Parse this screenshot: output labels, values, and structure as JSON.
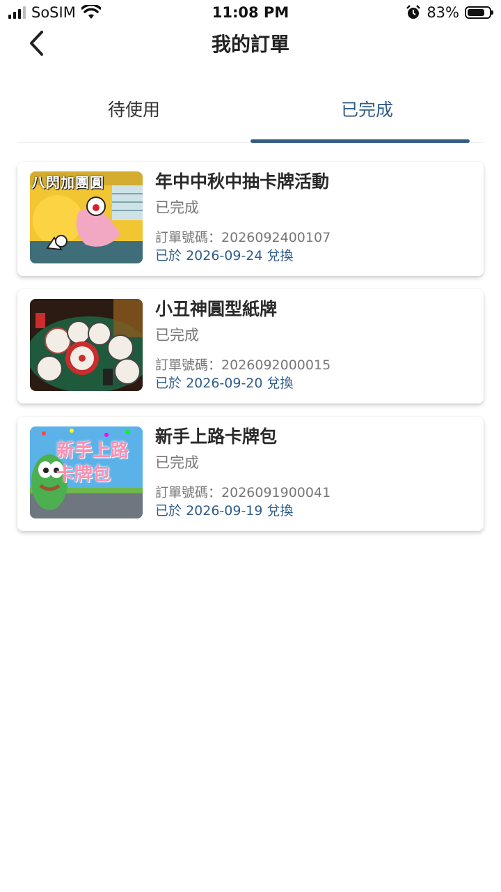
{
  "status_bar": {
    "carrier": "SoSIM",
    "time": "11:08 PM",
    "battery": "83%",
    "battery_level": 0.83,
    "icons": [
      "signal-icon",
      "wifi-icon",
      "alarm-icon",
      "battery-icon"
    ]
  },
  "header": {
    "title": "我的訂單",
    "back_icon": "chevron-left-icon"
  },
  "tabs": [
    {
      "label": "待使用",
      "active": false
    },
    {
      "label": "已完成",
      "active": true
    }
  ],
  "orders": [
    {
      "name": "年中中秋中抽卡牌活動",
      "status": "已完成",
      "order_label": "訂單號碼：",
      "order_no": "2026092400107",
      "redeem_prefix": "已於",
      "redeem_date": "2026-09-24",
      "redeem_suffix": "兌換",
      "thumb_text": "八閃加團圓"
    },
    {
      "name": "小丑神圓型紙牌",
      "status": "已完成",
      "order_label": "訂單號碼：",
      "order_no": "2026092000015",
      "redeem_prefix": "已於",
      "redeem_date": "2026-09-20",
      "redeem_suffix": "兌換",
      "thumb_text": ""
    },
    {
      "name": "新手上路卡牌包",
      "status": "已完成",
      "order_label": "訂單號碼：",
      "order_no": "2026091900041",
      "redeem_prefix": "已於",
      "redeem_date": "2026-09-19",
      "redeem_suffix": "兌換",
      "thumb_text": "新手上路卡牌包"
    }
  ],
  "colors": {
    "accent": "#345d86",
    "text": "#222222",
    "muted": "#777777"
  }
}
